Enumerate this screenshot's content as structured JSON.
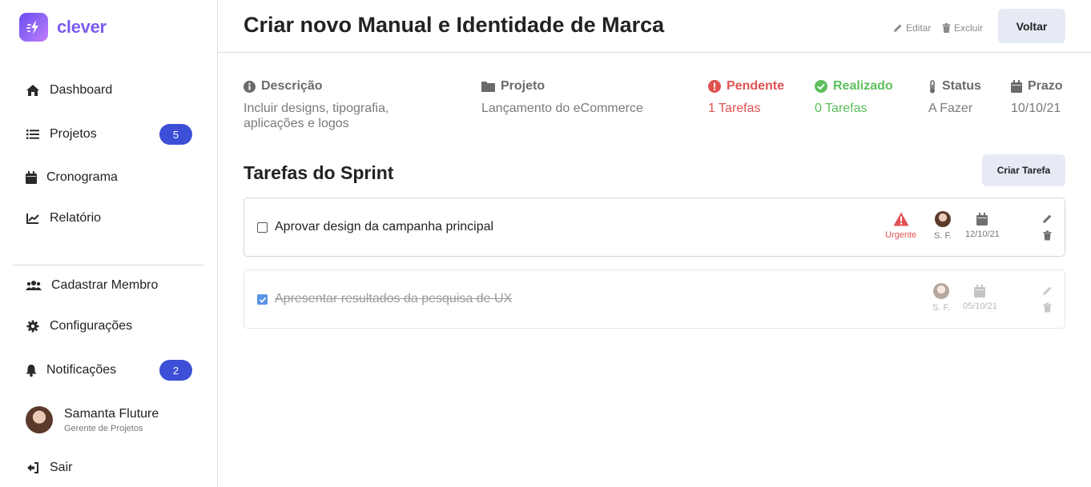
{
  "brand": {
    "name": "clever"
  },
  "sidebar": {
    "items": [
      {
        "label": "Dashboard",
        "icon": "home-icon"
      },
      {
        "label": "Projetos",
        "icon": "list-icon",
        "badge": "5"
      },
      {
        "label": "Cronograma",
        "icon": "calendar-icon"
      },
      {
        "label": "Relatório",
        "icon": "chart-line-icon"
      }
    ],
    "secondary_items": [
      {
        "label": "Cadastrar Membro",
        "icon": "users-icon"
      },
      {
        "label": "Configurações",
        "icon": "gear-icon"
      },
      {
        "label": "Notificações",
        "icon": "bell-icon",
        "badge": "2"
      }
    ],
    "user": {
      "name": "Samanta Fluture",
      "role": "Gerente de Projetos"
    },
    "logout_label": "Sair"
  },
  "header": {
    "title": "Criar novo Manual e Identidade de Marca",
    "edit_label": "Editar",
    "delete_label": "Excluir",
    "back_label": "Voltar"
  },
  "info": {
    "description": {
      "label": "Descrição",
      "value_line1": "Incluir designs, tipografia,",
      "value_line2": "aplicações e logos"
    },
    "project": {
      "label": "Projeto",
      "value": "Lançamento do eCommerce"
    },
    "pending": {
      "label": "Pendente",
      "value": "1 Tarefas"
    },
    "done": {
      "label": "Realizado",
      "value": "0 Tarefas"
    },
    "status": {
      "label": "Status",
      "value": "A Fazer"
    },
    "deadline": {
      "label": "Prazo",
      "value": "10/10/21"
    }
  },
  "tasks_section": {
    "title": "Tarefas do Sprint",
    "create_label": "Criar Tarefa",
    "tasks": [
      {
        "title": "Aprovar design da campanha principal",
        "checked": false,
        "priority": "Urgente",
        "assignee": "S. F.",
        "date": "12/10/21"
      },
      {
        "title": "Apresentar resultados da pesquisa de UX",
        "checked": true,
        "priority": "",
        "assignee": "S. F.",
        "date": "05/10/21"
      }
    ]
  },
  "colors": {
    "accent": "#3c4fd6",
    "brand": "#7b5cf2",
    "pending": "#e05252",
    "done": "#5cbf5c",
    "button_bg": "#e6eaf4"
  }
}
